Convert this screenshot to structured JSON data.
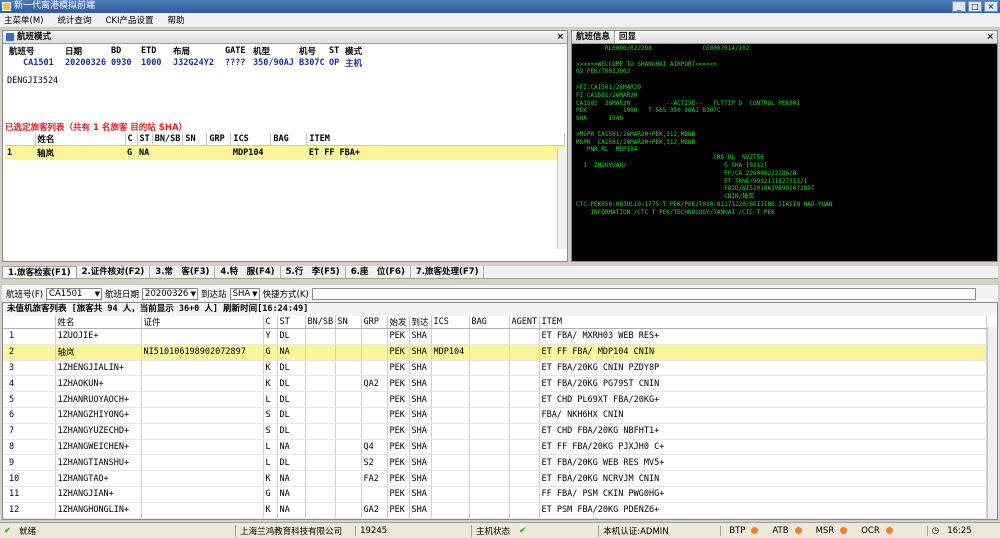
{
  "app_title": "新一代离港模拟前端",
  "menu": [
    "主菜单(M)",
    "统计查询",
    "CKI产品设置",
    "帮助"
  ],
  "flight_panel": {
    "title": "航班模式",
    "headers": [
      "航班号",
      "日期",
      "BD",
      "ETD",
      "布局",
      "GATE",
      "机型",
      "机号",
      "ST",
      "模式"
    ],
    "row": [
      "CA1501",
      "20200326",
      "0930",
      "1000",
      "J32G24Y2",
      "????",
      "350/90AJ",
      "B307C",
      "OP",
      "主机"
    ],
    "note": "DENGJI3524"
  },
  "selected": {
    "summary": "已选定旅客列表（共有 1 名旅客 目的站 SHA）",
    "headers": [
      "",
      "姓名",
      "C",
      "ST",
      "BN/SB",
      "SN",
      "GRP",
      "ICS",
      "BAG",
      "ITEM"
    ],
    "row": [
      "1",
      "轴岚",
      "G",
      "NA",
      "",
      "",
      "",
      "MDP104",
      "",
      "ET FF FBA+"
    ]
  },
  "right_panel": {
    "tabs": [
      "航班信息",
      "回显"
    ],
    "terminal_lines": [
      "        RL0000/022298              CE0007014/102",
      "",
      ">>>>>>WELCOME TO SHANGHAI AIRPORT<<<<<<",
      "02 PEK/T002J002",
      "",
      ">FI:CA1501/26MAR20",
      "FI CA1501/26MAR20",
      "CA1501  26MAR20          --ACTIVE--   FLTTIP D  CONTROL PEK001",
      "PEK          1000   T-565 350 90AJ B307C",
      "SHA      1040",
      "",
      ">MSPR CA1501/26MAR20+PEK,312,MBNB",
      "MSPR  CA1501/26MAR20+PEK,312,MBNB",
      "   PNR RL  MDP104",
      "                                      CRS RL  NVZT56",
      "  1  ZHOUYUAN/                           G SHA [0312]",
      "                                         FF/CA 226006222286/B",
      "                                         ET TKNE/9992111827313/1",
      "                                         FOID/NI510106198902072897",
      "                                         CNIN/轴岚",
      "CTC-PEK050-08JUL19-1775-T PEK/PEK/T010-81171220/BEIJING JIASIN HAO-YUAN",
      "    INFORMATION /CTC T PEK/TECHNOLOGY/TANHAI /CTC T PEK"
    ]
  },
  "tabs": [
    "1.旅客检索(F1)",
    "2.证件核对(F2)",
    "3.常　客(F3)",
    "4.特　服(F4)",
    "5.行　李(F5)",
    "6.座　位(F6)",
    "7.旅客处理(F7)"
  ],
  "filter": {
    "flight_label": "航班号(F)",
    "flight_value": "CA1501",
    "date_label": "航班日期",
    "date_value": "20200326",
    "dest_label": "到达站",
    "dest_value": "SHA",
    "quick_label": "快捷方式(K)"
  },
  "list_summary": "未值机旅客列表 [旅客共 94 人，当前显示 36+0 人] 刷新时间[16:24:49]",
  "list_headers": [
    "",
    "姓名",
    "证件",
    "C",
    "ST",
    "BN/SB",
    "SN",
    "GRP",
    "始发",
    "到达",
    "ICS",
    "BAG",
    "AGENT",
    "ITEM"
  ],
  "passengers": [
    [
      "1",
      "1ZUOJIE+",
      "",
      "Y",
      "DL",
      "",
      "",
      "",
      "PEK",
      "SHA",
      "",
      "",
      "",
      "ET FBA/ MXRH03 WEB RES+"
    ],
    [
      "2",
      "轴岚",
      "NI510106198902072897",
      "G",
      "NA",
      "",
      "",
      "",
      "PEK",
      "SHA",
      "MDP104",
      "",
      "",
      "ET FF FBA/ MDP104 CNIN"
    ],
    [
      "3",
      "1ZHENGJIALIN+",
      "",
      "K",
      "DL",
      "",
      "",
      "",
      "PEK",
      "SHA",
      "",
      "",
      "",
      "ET FBA/20KG CNIN PZDY8P"
    ],
    [
      "4",
      "1ZHAOKUN+",
      "",
      "K",
      "DL",
      "",
      "",
      "QA2",
      "PEK",
      "SHA",
      "",
      "",
      "",
      "ET FBA/20KG PG79ST CNIN"
    ],
    [
      "5",
      "1ZHANRUOYAOCH+",
      "",
      "L",
      "DL",
      "",
      "",
      "",
      "PEK",
      "SHA",
      "",
      "",
      "",
      "ET CHD PL69XT FBA/20KG+"
    ],
    [
      "6",
      "1ZHANGZHIYONG+",
      "",
      "S",
      "DL",
      "",
      "",
      "",
      "PEK",
      "SHA",
      "",
      "",
      "",
      "FBA/ NKH6HX CNIN"
    ],
    [
      "7",
      "1ZHANGYUZECHD+",
      "",
      "S",
      "DL",
      "",
      "",
      "",
      "PEK",
      "SHA",
      "",
      "",
      "",
      "ET CHD FBA/20KG NBFHT1+"
    ],
    [
      "8",
      "1ZHANGWEICHEN+",
      "",
      "L",
      "NA",
      "",
      "",
      "Q4",
      "PEK",
      "SHA",
      "",
      "",
      "",
      "ET FF FBA/20KG PJXJH0 C+"
    ],
    [
      "9",
      "1ZHANGTIANSHU+",
      "",
      "L",
      "DL",
      "",
      "",
      "S2",
      "PEK",
      "SHA",
      "",
      "",
      "",
      "ET FBA/20KG WEB RES MV5+"
    ],
    [
      "10",
      "1ZHANGTAO+",
      "",
      "K",
      "NA",
      "",
      "",
      "FA2",
      "PEK",
      "SHA",
      "",
      "",
      "",
      "ET FBA/20KG NCRVJM CNIN"
    ],
    [
      "11",
      "1ZHANGJIAN+",
      "",
      "G",
      "NA",
      "",
      "",
      "",
      "PEK",
      "SHA",
      "",
      "",
      "",
      "FF FBA/ PSM CKIN PWG0HG+"
    ],
    [
      "12",
      "1ZHANGHONGLIN+",
      "",
      "K",
      "NA",
      "",
      "",
      "GA2",
      "PEK",
      "SHA",
      "",
      "",
      "",
      "ET PSM FBA/20KG PDENZ6+"
    ]
  ],
  "status": {
    "ready": "就绪",
    "company": "上海兰鸿教育科技有限公司",
    "code": "19245",
    "host_state": "主机状态",
    "auth": "本机认证:ADMIN",
    "indicators": [
      "BTP",
      "ATB",
      "MSR",
      "OCR"
    ],
    "time": "16:25"
  }
}
